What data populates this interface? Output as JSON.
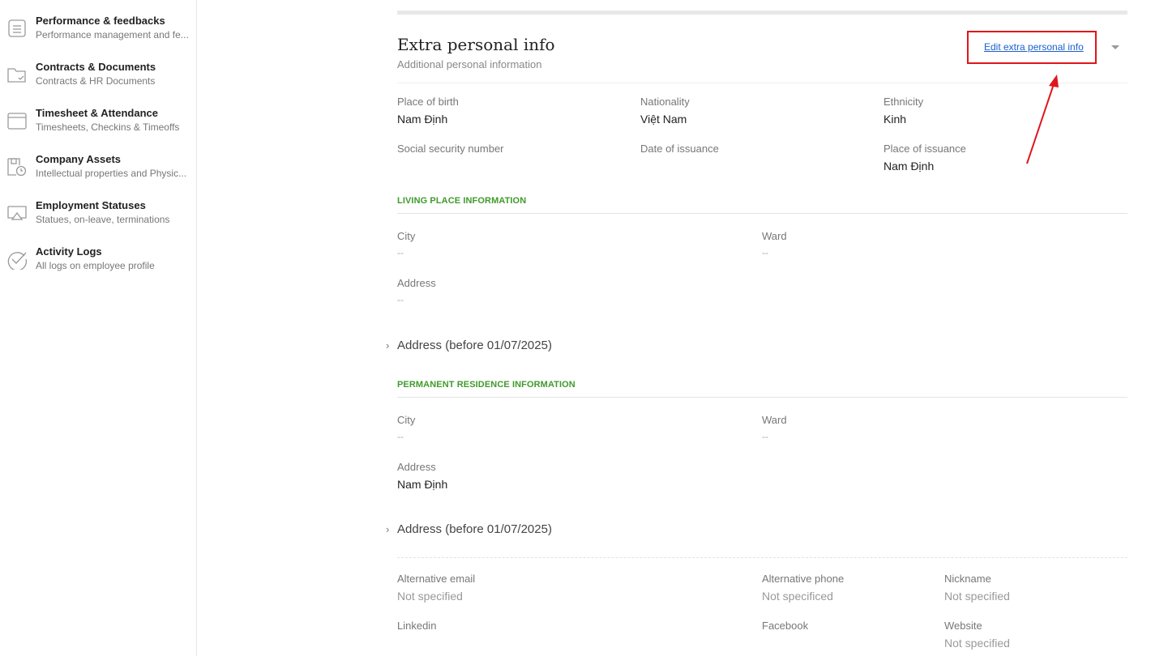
{
  "sidebar": {
    "items": [
      {
        "title": "Performance & feedbacks",
        "subtitle": "Performance management and fe...",
        "icon": "document-list-icon"
      },
      {
        "title": "Contracts & Documents",
        "subtitle": "Contracts & HR Documents",
        "icon": "folder-check-icon"
      },
      {
        "title": "Timesheet & Attendance",
        "subtitle": "Timesheets, Checkins & Timeoffs",
        "icon": "calendar-icon"
      },
      {
        "title": "Company Assets",
        "subtitle": "Intellectual properties and Physic...",
        "icon": "asset-clock-icon"
      },
      {
        "title": "Employment Statuses",
        "subtitle": "Statues, on-leave, terminations",
        "icon": "monitor-icon"
      },
      {
        "title": "Activity Logs",
        "subtitle": "All logs on employee profile",
        "icon": "check-circle-icon"
      }
    ]
  },
  "section": {
    "title": "Extra personal info",
    "subtitle": "Additional personal information",
    "edit_label": "Edit extra personal info",
    "highlight_color": "#e0161b"
  },
  "personal": {
    "place_of_birth": {
      "label": "Place of birth",
      "value": "Nam Định"
    },
    "nationality": {
      "label": "Nationality",
      "value": "Việt Nam"
    },
    "ethnicity": {
      "label": "Ethnicity",
      "value": "Kinh"
    },
    "ssn": {
      "label": "Social security number",
      "value": ""
    },
    "date_of_issuance": {
      "label": "Date of issuance",
      "value": ""
    },
    "place_of_issuance": {
      "label": "Place of issuance",
      "value": "Nam Định"
    }
  },
  "living": {
    "heading": "LIVING PLACE INFORMATION",
    "city": {
      "label": "City",
      "value": "--"
    },
    "ward": {
      "label": "Ward",
      "value": "--"
    },
    "address": {
      "label": "Address",
      "value": "--"
    },
    "old_address_toggle": "Address (before 01/07/2025)"
  },
  "permanent": {
    "heading": "PERMANENT RESIDENCE INFORMATION",
    "city": {
      "label": "City",
      "value": "--"
    },
    "ward": {
      "label": "Ward",
      "value": "--"
    },
    "address": {
      "label": "Address",
      "value": "Nam Định"
    },
    "old_address_toggle": "Address (before 01/07/2025)"
  },
  "contact": {
    "alt_email": {
      "label": "Alternative email",
      "value": "Not specified"
    },
    "alt_phone": {
      "label": "Alternative phone",
      "value": "Not specificed"
    },
    "nickname": {
      "label": "Nickname",
      "value": "Not specified"
    },
    "linkedin": {
      "label": "Linkedin",
      "value": ""
    },
    "facebook": {
      "label": "Facebook",
      "value": ""
    },
    "website": {
      "label": "Website",
      "value": "Not specified"
    }
  },
  "colors": {
    "accent_green": "#3f9b2b",
    "link_blue": "#1a5fcf",
    "annotation_red": "#e0161b"
  }
}
